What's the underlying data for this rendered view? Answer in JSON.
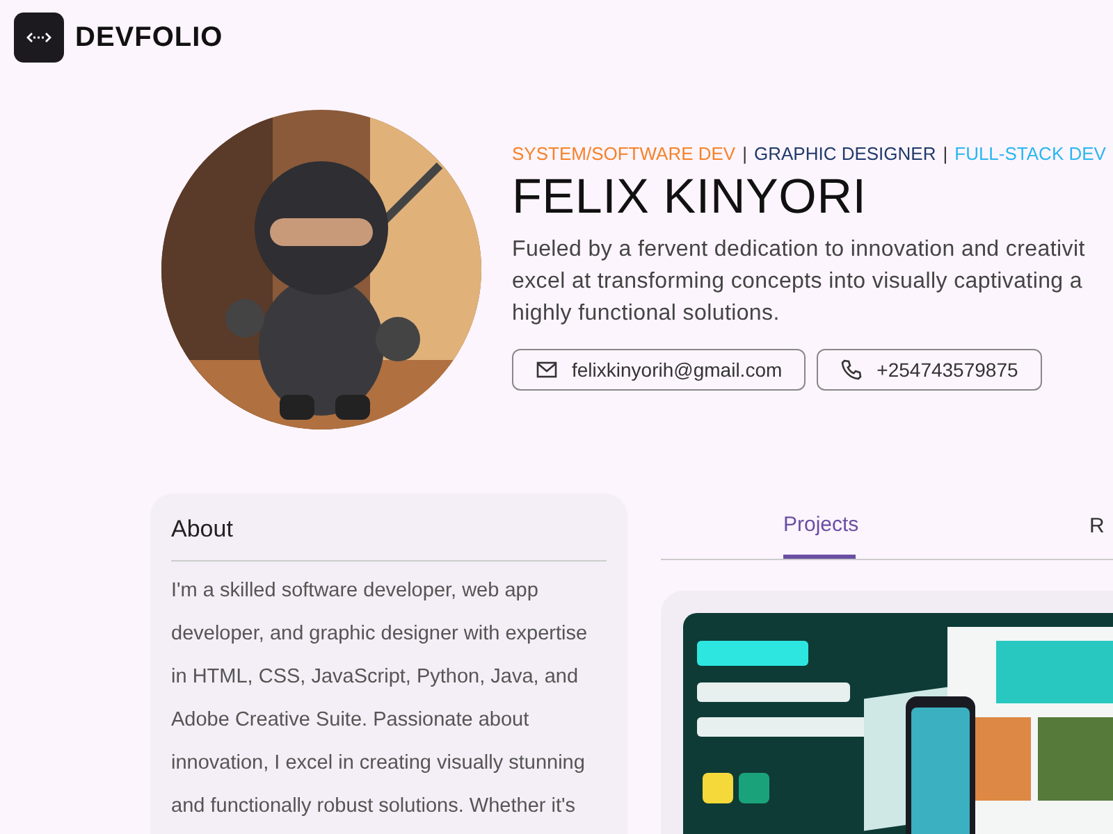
{
  "header": {
    "logo_text": "DEVFOLIO"
  },
  "profile": {
    "roles": [
      {
        "text": "SYSTEM/SOFTWARE DEV",
        "color": "#f5822a"
      },
      {
        "text": "GRAPHIC DESIGNER",
        "color": "#1f3a6b"
      },
      {
        "text": "FULL-STACK DEV",
        "color": "#29b6f0"
      }
    ],
    "separator": "|",
    "name": "FELIX KINYORI",
    "description_lines": [
      "Fueled by a fervent dedication to innovation and creativit",
      "excel at transforming concepts into visually captivating a",
      "highly functional solutions."
    ],
    "contacts": [
      {
        "kind": "email",
        "text": "felixkinyorih@gmail.com"
      },
      {
        "kind": "phone",
        "text": "+254743579875"
      }
    ]
  },
  "about": {
    "title": "About",
    "text": "I'm a skilled software developer, web app developer, and graphic designer with expertise in HTML, CSS, JavaScript, Python, Java, and Adobe Creative Suite. Passionate about innovation, I excel in creating visually stunning and functionally robust solutions. Whether it's"
  },
  "tabs": [
    {
      "label": "Projects",
      "selected": true
    },
    {
      "label": "R",
      "selected": false
    }
  ]
}
